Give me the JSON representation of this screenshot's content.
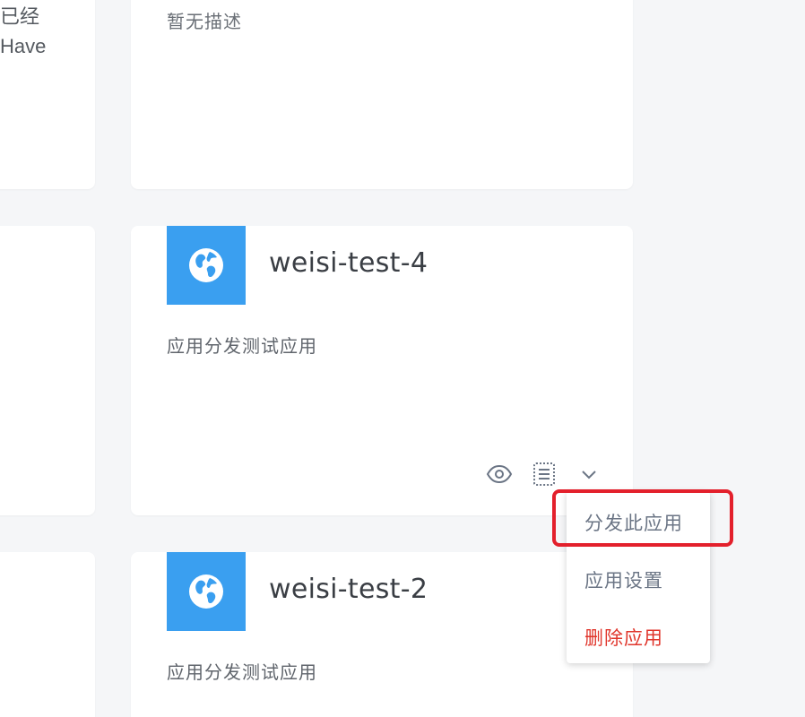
{
  "left_column": {
    "top_card": {
      "line1": "已经",
      "line2": "Have"
    }
  },
  "cards": [
    {
      "description": "暂无描述"
    },
    {
      "name": "weisi-test-4",
      "description": "应用分发测试应用",
      "icon": "globe-icon",
      "actions": {
        "preview_icon": "eye-icon",
        "log_icon": "document-list-icon",
        "more_icon": "chevron-down-icon"
      }
    },
    {
      "name": "weisi-test-2",
      "description": "应用分发测试应用",
      "icon": "globe-icon"
    }
  ],
  "dropdown": {
    "items": [
      {
        "label": "分发此应用",
        "highlighted": true
      },
      {
        "label": "应用设置"
      },
      {
        "label": "删除应用",
        "danger": true
      }
    ]
  },
  "colors": {
    "background": "#f5f6f8",
    "card": "#ffffff",
    "icon_tile": "#3a9ff0",
    "danger": "#e0352b",
    "menu_text": "#6b7585",
    "highlight_border": "#e3202c"
  }
}
